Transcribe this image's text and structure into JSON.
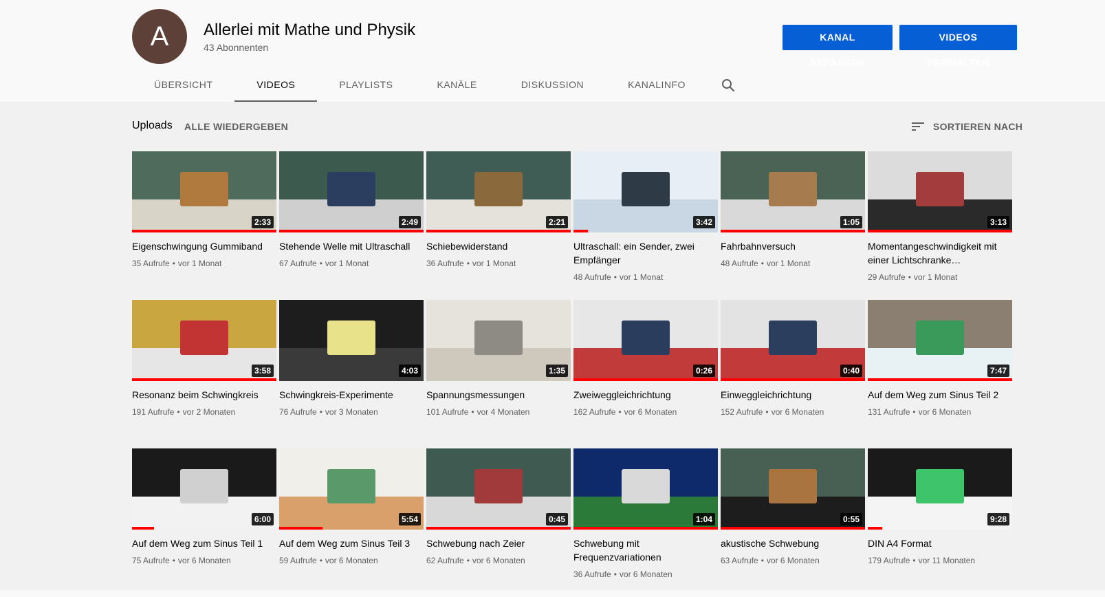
{
  "channel": {
    "avatar_letter": "A",
    "title": "Allerlei mit Mathe und Physik",
    "subscribers": "43 Abonnenten",
    "customize_label": "KANAL ANPASSEN",
    "manage_label": "VIDEOS VERWALTEN"
  },
  "tabs": [
    {
      "label": "ÜBERSICHT",
      "active": false
    },
    {
      "label": "VIDEOS",
      "active": true
    },
    {
      "label": "PLAYLISTS",
      "active": false
    },
    {
      "label": "KANÄLE",
      "active": false
    },
    {
      "label": "DISKUSSION",
      "active": false
    },
    {
      "label": "KANALINFO",
      "active": false
    }
  ],
  "section": {
    "title": "Uploads",
    "play_all": "ALLE WIEDERGEBEN",
    "sort_by": "SORTIEREN NACH"
  },
  "colors": {
    "accent": "#065fd4",
    "progress": "#ff0000",
    "avatar": "#5d4037"
  },
  "videos": [
    {
      "title": "Eigenschwingung Gummiband",
      "views": "35 Aufrufe",
      "age": "vor 1 Monat",
      "duration": "2:33",
      "watched": 1.0,
      "thumb": [
        "#4e6b5c",
        "#d8d4c8",
        "#b07a3f"
      ]
    },
    {
      "title": "Stehende Welle mit Ultraschall",
      "views": "67 Aufrufe",
      "age": "vor 1 Monat",
      "duration": "2:49",
      "watched": 1.0,
      "thumb": [
        "#3d5a4f",
        "#cfcfcf",
        "#2c3e60"
      ]
    },
    {
      "title": "Schiebewiderstand",
      "views": "36 Aufrufe",
      "age": "vor 1 Monat",
      "duration": "2:21",
      "watched": 1.0,
      "thumb": [
        "#3f5d55",
        "#e5e2dc",
        "#8a6a3c"
      ]
    },
    {
      "title": "Ultraschall: ein Sender, zwei Empfänger",
      "views": "48 Aufrufe",
      "age": "vor 1 Monat",
      "duration": "3:42",
      "watched": 0.1,
      "thumb": [
        "#e8eef5",
        "#c9d6e3",
        "#2e3a46"
      ]
    },
    {
      "title": "Fahrbahnversuch",
      "views": "48 Aufrufe",
      "age": "vor 1 Monat",
      "duration": "1:05",
      "watched": 1.0,
      "thumb": [
        "#4a6355",
        "#d9d9d9",
        "#a67c4e"
      ]
    },
    {
      "title": "Momentangeschwindigkeit mit einer Lichtschranke…",
      "views": "29 Aufrufe",
      "age": "vor 1 Monat",
      "duration": "3:13",
      "watched": 1.0,
      "thumb": [
        "#dcdcdc",
        "#2a2a2a",
        "#a33c3c"
      ]
    },
    {
      "title": "Resonanz beim Schwingkreis",
      "views": "191 Aufrufe",
      "age": "vor 2 Monaten",
      "duration": "3:58",
      "watched": 1.0,
      "thumb": [
        "#c9a640",
        "#e6e6e6",
        "#c23434"
      ]
    },
    {
      "title": "Schwingkreis-Experimente",
      "views": "76 Aufrufe",
      "age": "vor 3 Monaten",
      "duration": "4:03",
      "watched": 0.0,
      "thumb": [
        "#1d1d1d",
        "#3a3a3a",
        "#e8e28a"
      ]
    },
    {
      "title": "Spannungsmessungen",
      "views": "101 Aufrufe",
      "age": "vor 4 Monaten",
      "duration": "1:35",
      "watched": 0.0,
      "thumb": [
        "#e6e3dd",
        "#cfc8bd",
        "#8e8a84"
      ]
    },
    {
      "title": "Zweiweggleichrichtung",
      "views": "162 Aufrufe",
      "age": "vor 6 Monaten",
      "duration": "0:26",
      "watched": 1.0,
      "thumb": [
        "#e7e7e7",
        "#c23b3b",
        "#2b3d5c"
      ]
    },
    {
      "title": "Einweggleichrichtung",
      "views": "152 Aufrufe",
      "age": "vor 6 Monaten",
      "duration": "0:40",
      "watched": 1.0,
      "thumb": [
        "#e3e3e3",
        "#c33a3a",
        "#2c3e5e"
      ]
    },
    {
      "title": "Auf dem Weg zum Sinus Teil 2",
      "views": "131 Aufrufe",
      "age": "vor 6 Monaten",
      "duration": "7:47",
      "watched": 1.0,
      "thumb": [
        "#8a7f70",
        "#e8f2f4",
        "#3a9a5a"
      ]
    },
    {
      "title": "Auf dem Weg zum Sinus Teil 1",
      "views": "75 Aufrufe",
      "age": "vor 6 Monaten",
      "duration": "6:00",
      "watched": 0.15,
      "thumb": [
        "#1a1a1a",
        "#f2f2f2",
        "#d0d0d0"
      ]
    },
    {
      "title": "Auf dem Weg zum Sinus Teil 3",
      "views": "59 Aufrufe",
      "age": "vor 6 Monaten",
      "duration": "5:54",
      "watched": 0.3,
      "thumb": [
        "#f0efe9",
        "#d9a06b",
        "#5a9a6a"
      ]
    },
    {
      "title": "Schwebung nach Zeier",
      "views": "62 Aufrufe",
      "age": "vor 6 Monaten",
      "duration": "0:45",
      "watched": 1.0,
      "thumb": [
        "#3f5a50",
        "#d8d8d8",
        "#a13b3b"
      ]
    },
    {
      "title": "Schwebung mit Frequenzvariationen",
      "views": "36 Aufrufe",
      "age": "vor 6 Monaten",
      "duration": "1:04",
      "watched": 1.0,
      "thumb": [
        "#0e2a6a",
        "#2c7a3a",
        "#d9d9d9"
      ]
    },
    {
      "title": "akustische Schwebung",
      "views": "63 Aufrufe",
      "age": "vor 6 Monaten",
      "duration": "0:55",
      "watched": 1.0,
      "thumb": [
        "#485f54",
        "#1d1d1d",
        "#a97440"
      ]
    },
    {
      "title": "DIN A4 Format",
      "views": "179 Aufrufe",
      "age": "vor 11 Monaten",
      "duration": "9:28",
      "watched": 0.1,
      "thumb": [
        "#1a1a1a",
        "#f4f4f4",
        "#3ec46a"
      ]
    }
  ]
}
